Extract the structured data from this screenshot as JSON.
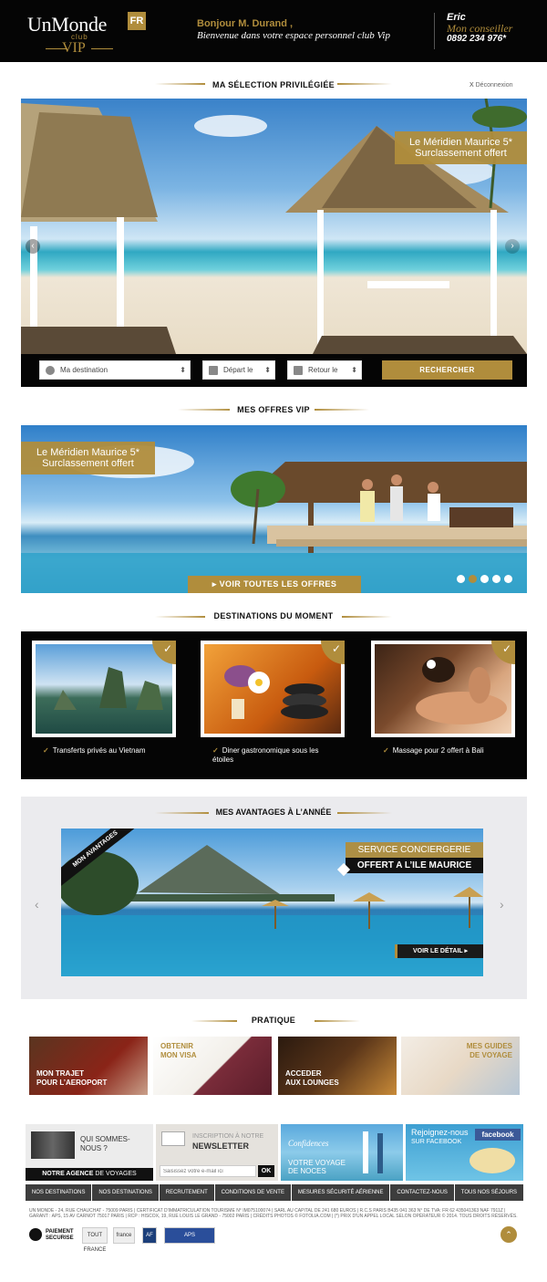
{
  "header": {
    "logo": {
      "name": "UnMonde",
      "country": "FR",
      "club": "club",
      "tier": "VIP"
    },
    "greeting": "Bonjour M. Durand ,",
    "welcome": "Bienvenue dans votre espace personnel club Vip",
    "advisor": {
      "name": "Eric",
      "role": "Mon conseiller",
      "phone": "0892 234 976*"
    }
  },
  "selection": {
    "title": "MA SÉLECTION PRIVILÉGIÉE",
    "logout": "Déconnexion",
    "logout_prefix": "X",
    "banner_line1": "Le Méridien Maurice 5*",
    "banner_line2": "Surclassement offert"
  },
  "search": {
    "destination": "Ma destination",
    "depart": "Départ le",
    "retour": "Retour le",
    "button": "RECHERCHER"
  },
  "offers": {
    "title": "MES OFFRES VIP",
    "banner_line1": "Le Méridien Maurice 5*",
    "banner_line2": "Surclassement offert",
    "cta": "VOIR TOUTES LES OFFRES",
    "dots": 5
  },
  "destinations": {
    "title": "DESTINATIONS DU MOMENT",
    "items": [
      {
        "caption": "Transferts privés au Vietnam"
      },
      {
        "caption": "Diner gastronomique sous les étoiles"
      },
      {
        "caption": "Massage pour 2 offert à Bali"
      }
    ]
  },
  "advantages": {
    "title": "MES AVANTAGES À L’ANNÉE",
    "ribbon": "MON AVANTAGES",
    "service_line1": "SERVICE CONCIERGERIE",
    "service_line2": "OFFERT A L’ILE MAURICE",
    "cta": "VOIR LE DÉTAIL"
  },
  "pratique": {
    "title": "PRATIQUE",
    "items": [
      {
        "line1": "MON TRAJET",
        "line2": "POUR L’AEROPORT"
      },
      {
        "line1": "OBTENIR",
        "line2": "MON VISA"
      },
      {
        "line1": "ACCEDER",
        "line2": "AUX LOUNGES"
      },
      {
        "line1": "MES GUIDES",
        "line2": "DE VOYAGE"
      }
    ]
  },
  "footer_promos": {
    "agency_q": "QUI SOMMES-NOUS ?",
    "agency_label_bold": "NOTRE AGENCE",
    "agency_label_rest": "DE VOYAGES",
    "newsletter_top": "INSCRIPTION À NOTRE",
    "newsletter_title": "NEWSLETTER",
    "newsletter_placeholder": "Saisissez votre e-mail ici",
    "newsletter_ok": "OK",
    "wedding_brand": "Confidences",
    "wedding_line1": "VOTRE VOYAGE",
    "wedding_line2": "DE NOCES",
    "facebook_line1": "Rejoignez-nous",
    "facebook_line2": "SUR FACEBOOK",
    "facebook_logo": "facebook"
  },
  "footer_nav": [
    "NOS DESTINATIONS",
    "NOS DESTINATIONS",
    "RECRUTEMENT",
    "CONDITIONS DE VENTE",
    "MESURES SÉCURITÉ AÉRIENNE",
    "CONTACTEZ-NOUS",
    "TOUS NOS SÉJOURS"
  ],
  "legal": "UN MONDE - 24, RUE CHAUCHAT - 75009 PARIS | CERTIFICAT D'IMMATRICULATION TOURISME N° IM075100074 | SARL AU CAPITAL DE 241 680 EUROS | R.C.S PARIS B435 041 363 N° DE TVA: FR 62 435041363 NAF 7911Z | GARANT : APS, 15 AV CARNOT 75017 PARIS | RCP : HISCOX, 19, RUE LOUIS LE GRAND - 75002 PARIS | CRÉDITS PHOTOS © FOTOLIA.COM | (*) PRIX D'UN APPEL LOCAL SELON OPÉRATEUR © 2014. TOUS DROITS RÉSERVÉS.",
  "footer_badges": {
    "payment_line1": "PAIEMENT",
    "payment_line2": "SECURISE",
    "badge2": "TOUT FRANCE",
    "badge3": "france",
    "badge4": "AF",
    "badge5": "APS"
  },
  "colors": {
    "gold": "#b08d3c",
    "black": "#050505",
    "dark": "#3d3d3d"
  }
}
